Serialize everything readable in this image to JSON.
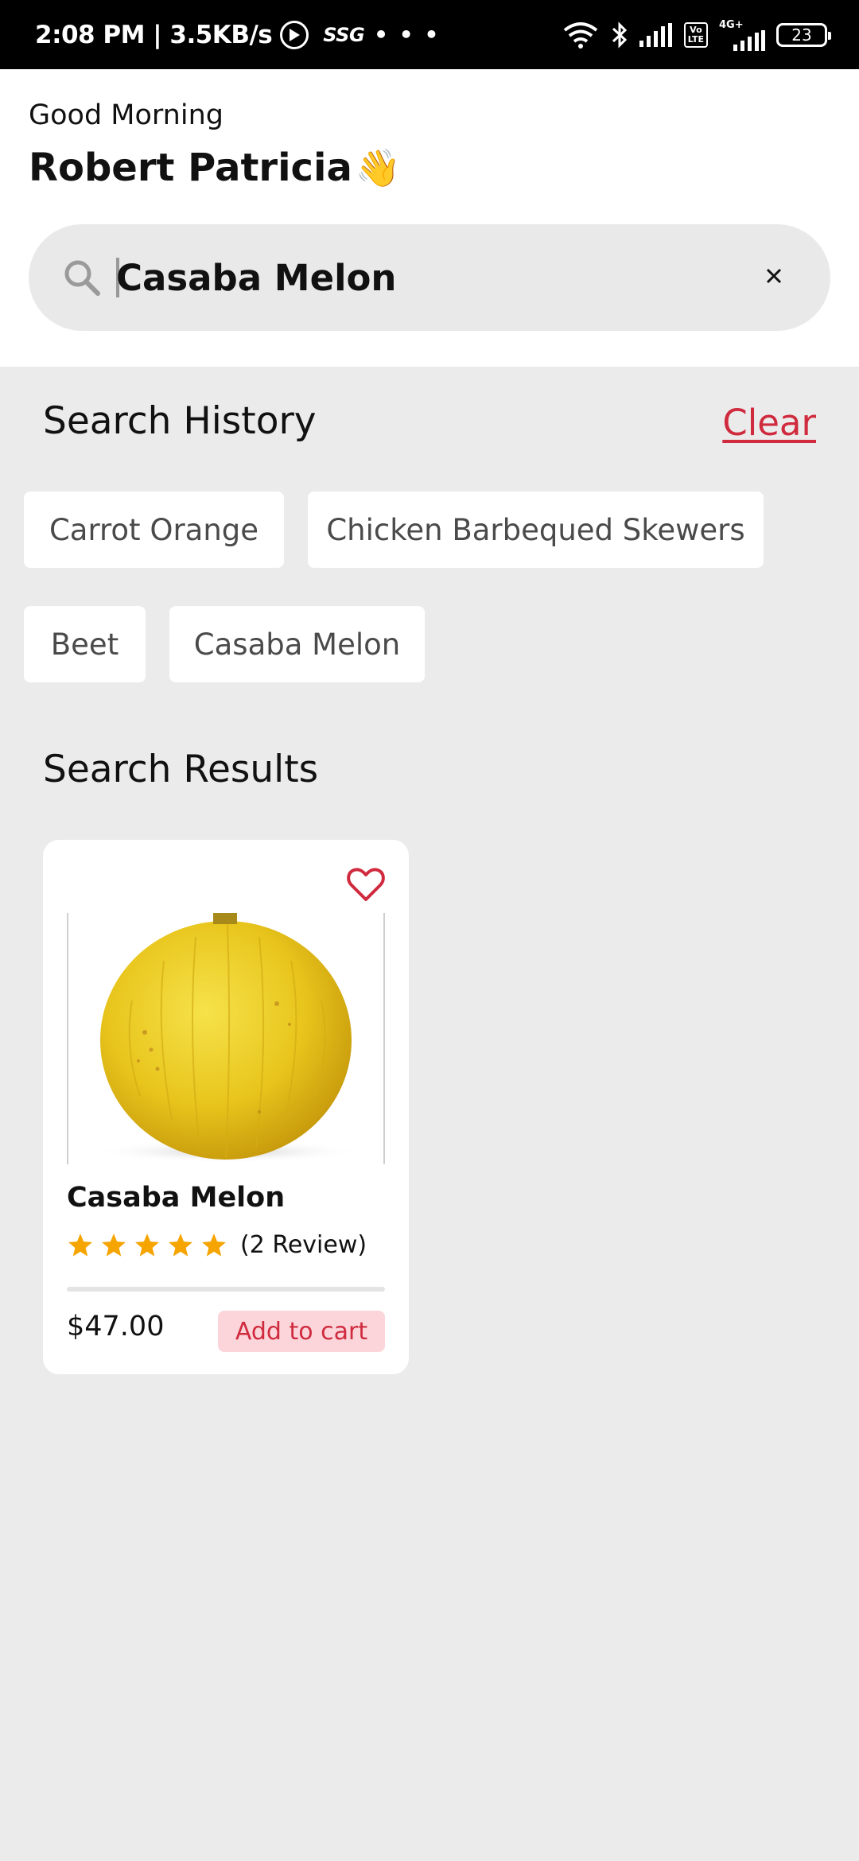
{
  "status_bar": {
    "time": "2:08 PM",
    "network_speed": "3.5KB/s",
    "carrier_tag": "SSG",
    "more": "• • •",
    "volte_line1": "Vo",
    "volte_line2": "LTE",
    "network_type": "4G+",
    "battery": "23"
  },
  "header": {
    "greeting": "Good Morning",
    "user_name": "Robert Patricia",
    "wave_emoji": "👋"
  },
  "search": {
    "value": "Casaba Melon",
    "icon": "search-icon",
    "clear_icon": "close-icon"
  },
  "history": {
    "title": "Search History",
    "clear_label": "Clear",
    "items": [
      "Carrot Orange",
      "Chicken Barbequed Skewers",
      "Beet",
      "Casaba Melon"
    ]
  },
  "results": {
    "title": "Search Results",
    "items": [
      {
        "name": "Casaba Melon",
        "rating": 5,
        "reviews": "(2 Review)",
        "price": "$47.00",
        "add_label": "Add to cart"
      }
    ]
  },
  "colors": {
    "accent": "#d02a3e",
    "star": "#f5a400",
    "add_button_bg": "#fbd5da",
    "background": "#ebebeb"
  }
}
